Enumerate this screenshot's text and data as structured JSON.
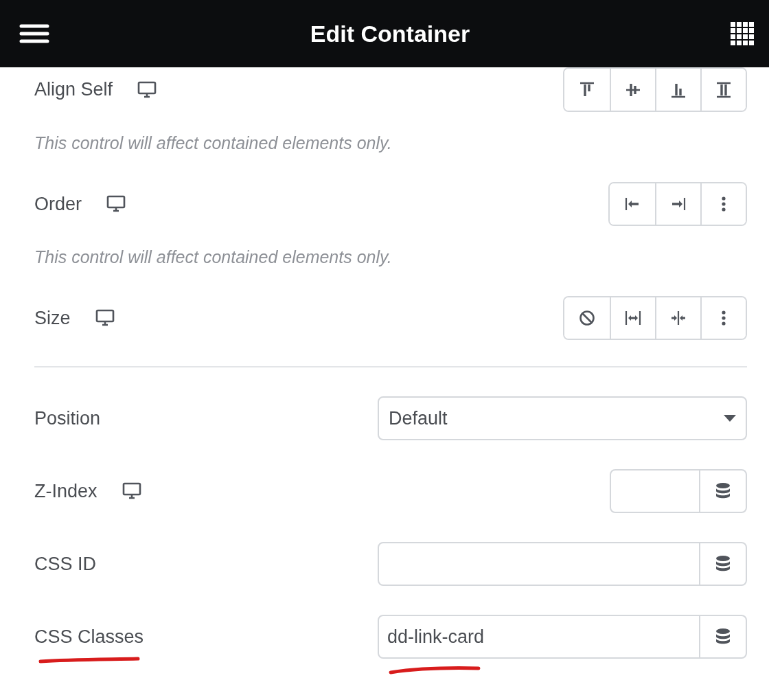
{
  "header": {
    "title": "Edit Container"
  },
  "rows": [
    {
      "kind": "buttons",
      "label": "Align Self",
      "responsive": true,
      "note": "This control will affect contained elements only."
    },
    {
      "kind": "buttons",
      "label": "Order",
      "responsive": true,
      "note": "This control will affect contained elements only."
    },
    {
      "kind": "buttons",
      "label": "Size",
      "responsive": true
    },
    {
      "kind": "divider"
    },
    {
      "kind": "select",
      "label": "Position",
      "responsive": false,
      "value": "Default"
    },
    {
      "kind": "number",
      "label": "Z-Index",
      "responsive": true,
      "value": "",
      "annotated": false
    },
    {
      "kind": "input",
      "label": "CSS ID",
      "responsive": false,
      "value": "",
      "annotated": false
    },
    {
      "kind": "input",
      "label": "CSS Classes",
      "responsive": false,
      "value": "dd-link-card",
      "annotated": true
    }
  ]
}
